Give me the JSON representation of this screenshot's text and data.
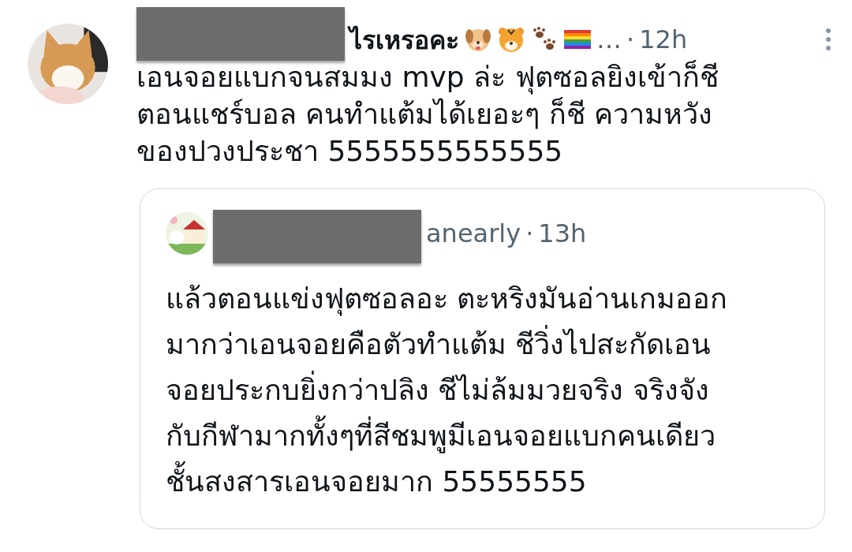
{
  "post": {
    "author": {
      "name_visible": "ไรเหรอคะ",
      "redacted": true,
      "emoji": [
        {
          "kind": "dog"
        },
        {
          "kind": "tiger"
        },
        {
          "kind": "paw"
        },
        {
          "kind": "rainbow_flag"
        }
      ],
      "ellipsis": "…",
      "separator": "·",
      "time": "12h"
    },
    "text": "เอนจอยแบกจนสมมง mvp ล่ะ ฟุตซอลยิงเข้าก็ชี\nตอนแชร์บอล คนทำแต้มได้เยอะๆ ก็ชี ความหวัง\nของปวงประชา 5555555555555",
    "quote": {
      "author": {
        "handle_visible": "anearly",
        "redacted": true,
        "separator": "·",
        "time": "13h"
      },
      "text": "แล้วตอนแข่งฟุตซอลอะ ตะหริงมันอ่านเกมออก\nมากว่าเอนจอยคือตัวทำแต้ม ชีวิ่งไปสะกัดเอน\nจอยประกบยิ่งกว่าปลิง ชีไม่ล้มมวยจริง จริงจัง\nกับกีฬามากทั้งๆที่สีชมพูมีเอนจอยแบกคนเดียว\nชั้นสงสารเอนจอยมาก 55555555"
    }
  }
}
